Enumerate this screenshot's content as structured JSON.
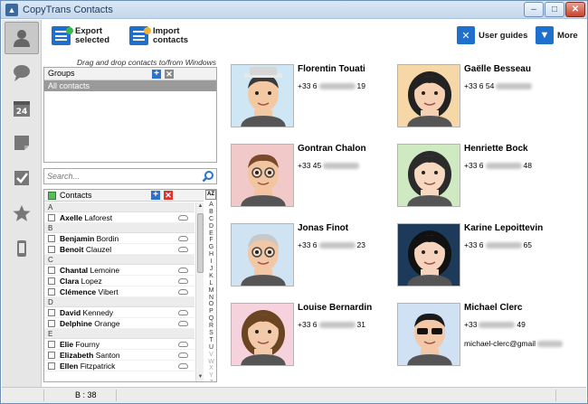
{
  "window": {
    "title": "CopyTrans Contacts"
  },
  "toolbar": {
    "export_line1": "Export",
    "export_line2": "selected",
    "import_line1": "Import",
    "import_line2": "contacts",
    "user_guides": "User guides",
    "more": "More"
  },
  "nav": [
    "contacts",
    "messages",
    "calendar",
    "notes",
    "tasks",
    "bookmarks",
    "phone"
  ],
  "calendar_day": "24",
  "drag_hint": "Drag and drop contacts to/from Windows",
  "groups": {
    "label": "Groups",
    "items": [
      "All contacts"
    ]
  },
  "search": {
    "placeholder": "Search..."
  },
  "contacts_header": "Contacts",
  "az": "AZ",
  "contact_list": [
    {
      "letter": "A",
      "rows": [
        {
          "first": "Axelle",
          "last": "Laforest"
        }
      ]
    },
    {
      "letter": "B",
      "rows": [
        {
          "first": "Benjamin",
          "last": "Bordin"
        },
        {
          "first": "Benoit",
          "last": "Clauzel"
        }
      ]
    },
    {
      "letter": "C",
      "rows": [
        {
          "first": "Chantal",
          "last": "Lemoine"
        },
        {
          "first": "Clara",
          "last": "Lopez"
        },
        {
          "first": "Clémence",
          "last": "Vibert"
        }
      ]
    },
    {
      "letter": "D",
      "rows": [
        {
          "first": "David",
          "last": "Kennedy"
        },
        {
          "first": "Delphine",
          "last": "Orange"
        }
      ]
    },
    {
      "letter": "E",
      "rows": [
        {
          "first": "Elie",
          "last": "Fourny"
        },
        {
          "first": "Elizabeth",
          "last": "Santon"
        },
        {
          "first": "Ellen",
          "last": "Fitzpatrick"
        }
      ]
    }
  ],
  "alphabet": [
    "A",
    "B",
    "C",
    "D",
    "E",
    "F",
    "G",
    "H",
    "I",
    "J",
    "K",
    "L",
    "M",
    "N",
    "O",
    "P",
    "Q",
    "R",
    "S",
    "T",
    "U",
    "V",
    "W",
    "X",
    "Y",
    "Z",
    "#"
  ],
  "status": "B : 38",
  "cards": [
    {
      "name": "Florentin Touati",
      "phone_start": "+33 6",
      "phone_end": "19",
      "email": ""
    },
    {
      "name": "Gaëlle Besseau",
      "phone_start": "+33 6 54",
      "phone_end": "",
      "email": ""
    },
    {
      "name": "Gontran Chalon",
      "phone_start": "+33 45",
      "phone_end": "",
      "email": ""
    },
    {
      "name": "Henriette Bock",
      "phone_start": "+33 6",
      "phone_end": "48",
      "email": ""
    },
    {
      "name": "Jonas Finot",
      "phone_start": "+33 6",
      "phone_end": "23",
      "email": ""
    },
    {
      "name": "Karine Lepoittevin",
      "phone_start": "+33 6",
      "phone_end": "65",
      "email": ""
    },
    {
      "name": "Louise Bernardin",
      "phone_start": "+33 6",
      "phone_end": "31",
      "email": ""
    },
    {
      "name": "Michael Clerc",
      "phone_start": "+33",
      "phone_end": "49",
      "email": "michael-clerc@gmail"
    }
  ],
  "colors": {
    "accent": "#1f6fcc",
    "group_selected": "#9a9a9a"
  }
}
